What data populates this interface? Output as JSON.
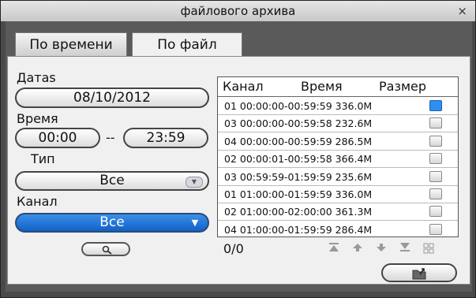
{
  "window": {
    "title": "файлового архива",
    "close_glyph": "×"
  },
  "tabs": [
    {
      "label": "По времени"
    },
    {
      "label": "По файл"
    }
  ],
  "form": {
    "date_label": "Датаs",
    "date_value": "08/10/2012",
    "time_label": "Время",
    "time_from": "00:00",
    "time_sep": "--",
    "time_to": "23:59",
    "type_label": "Тип",
    "type_value": "Все",
    "channel_label": "Канал",
    "channel_value": "Все"
  },
  "file_list": {
    "columns": [
      "Канал",
      "Время",
      "Размер"
    ],
    "rows": [
      {
        "text": "01 00:00:00-00:59:59 336.0M",
        "checked": true
      },
      {
        "text": "03 00:00:00-00:59:58 232.6M",
        "checked": false
      },
      {
        "text": "04 00:00:00-00:59:59 286.5M",
        "checked": false
      },
      {
        "text": "02 00:00:01-00:59:58 366.4M",
        "checked": false
      },
      {
        "text": "03 00:59:59-01:59:59 235.6M",
        "checked": false
      },
      {
        "text": "01 01:00:00-01:59:59 336.0M",
        "checked": false
      },
      {
        "text": "02 01:00:00-02:00:00 361.3M",
        "checked": false
      },
      {
        "text": "04 01:00:00-01:59:59 286.4M",
        "checked": false
      }
    ]
  },
  "pager": {
    "counter": "0/0"
  },
  "icons": {
    "first": "first-page-icon",
    "prev": "prev-page-icon",
    "next": "next-page-icon",
    "last": "last-page-icon",
    "select_all": "select-all-icon",
    "search": "search-icon",
    "export": "export-folder-icon"
  },
  "colors": {
    "selected": "#1a6fd8",
    "checked": "#2e8ff0"
  }
}
